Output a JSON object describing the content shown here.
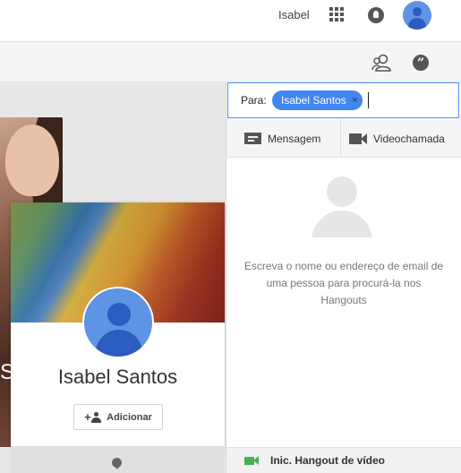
{
  "topbar": {
    "user_name": "Isabel"
  },
  "profile_card": {
    "name": "Isabel Santos",
    "add_label": "Adicionar"
  },
  "photo": {
    "visible_text": "Sá"
  },
  "hangouts": {
    "to_label": "Para:",
    "recipient_chip": "Isabel Santos",
    "chip_remove": "×",
    "message_label": "Mensagem",
    "video_call_label": "Videochamada",
    "hint_text": "Escreva o nome ou endereço de email de uma pessoa para procurá-la nos Hangouts",
    "start_video_label": "Inic. Hangout de vídeo"
  },
  "icons": {
    "apps": "apps-grid-icon",
    "notifications": "bell-icon",
    "account": "avatar-icon",
    "contacts": "people-icon",
    "hangouts": "hangouts-quote-icon",
    "message": "message-icon",
    "video": "video-camera-icon",
    "add_person": "add-person-icon",
    "comment": "comment-icon"
  },
  "colors": {
    "accent_blue": "#4285f4",
    "focus_border": "#4d90fe",
    "video_green": "#4caf50"
  }
}
